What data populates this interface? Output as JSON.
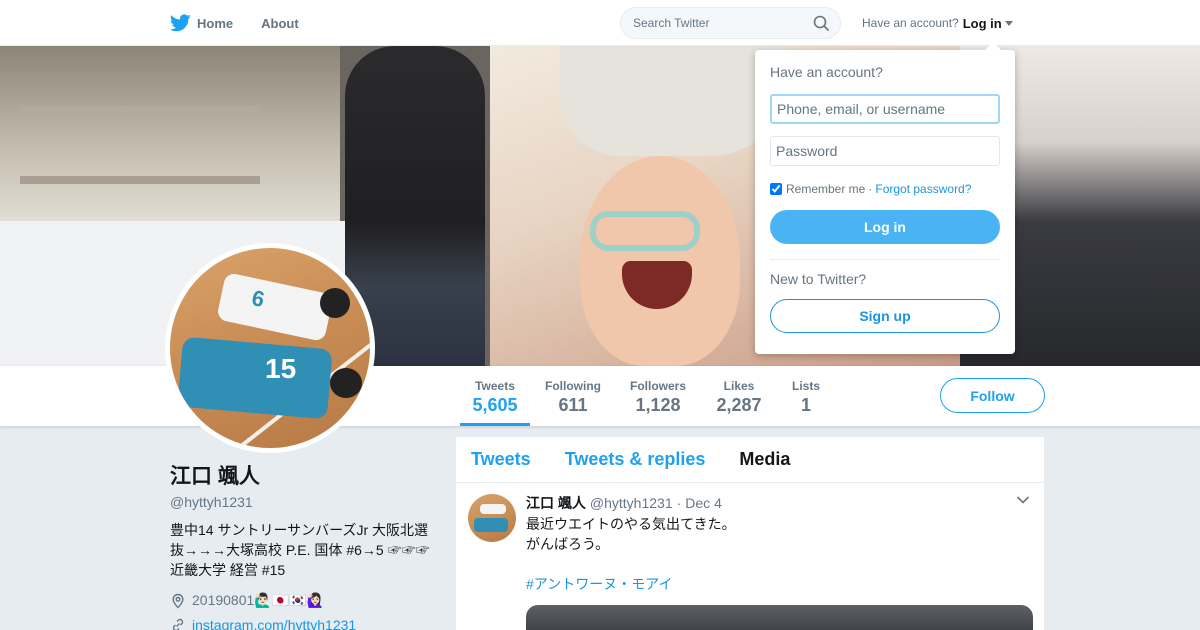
{
  "nav": {
    "home_label": "Home",
    "about_label": "About",
    "search_placeholder": "Search Twitter",
    "account_prompt": "Have an account?",
    "login_label": "Log in"
  },
  "login_panel": {
    "title": "Have an account?",
    "username_placeholder": "Phone, email, or username",
    "password_placeholder": "Password",
    "remember_label": "Remember me",
    "separator": "·",
    "forgot_label": "Forgot password?",
    "login_button": "Log in",
    "new_prompt": "New to Twitter?",
    "signup_button": "Sign up"
  },
  "stats": [
    {
      "label": "Tweets",
      "value": "5,605"
    },
    {
      "label": "Following",
      "value": "611"
    },
    {
      "label": "Followers",
      "value": "1,128"
    },
    {
      "label": "Likes",
      "value": "2,287"
    },
    {
      "label": "Lists",
      "value": "1"
    }
  ],
  "follow_button": "Follow",
  "profile": {
    "name": "江口 颯人",
    "handle": "@hyttyh1231",
    "bio_line1": "豊中14 サントリーサンバーズJr 大阪北選",
    "bio_line2": "抜→→→大塚高校 P.E. 国体 #6→5 ☞☞☞",
    "bio_line3": "近畿大学 経営 #15",
    "location": "20190801🙋🏻‍♂️🇯🇵🇰🇷🙋🏻‍♀️",
    "link": "instagram.com/hyttyh1231"
  },
  "timeline": {
    "tabs": [
      "Tweets",
      "Tweets & replies",
      "Media"
    ]
  },
  "tweet": {
    "name": "江口 颯人",
    "handle": "@hyttyh1231",
    "separator": "·",
    "date": "Dec 4",
    "line1": "最近ウエイトのやる気出てきた。",
    "line2": "がんばろう。",
    "hashtag": "#アントワーヌ・モアイ"
  },
  "colors": {
    "accent": "#1da1f2",
    "link": "#1b95e0",
    "background": "#e6ecf0"
  },
  "icons": {
    "logo": "twitter-bird-icon",
    "search": "search-icon",
    "location": "location-pin-icon",
    "link": "link-icon",
    "tweet_menu": "chevron-down-icon"
  }
}
